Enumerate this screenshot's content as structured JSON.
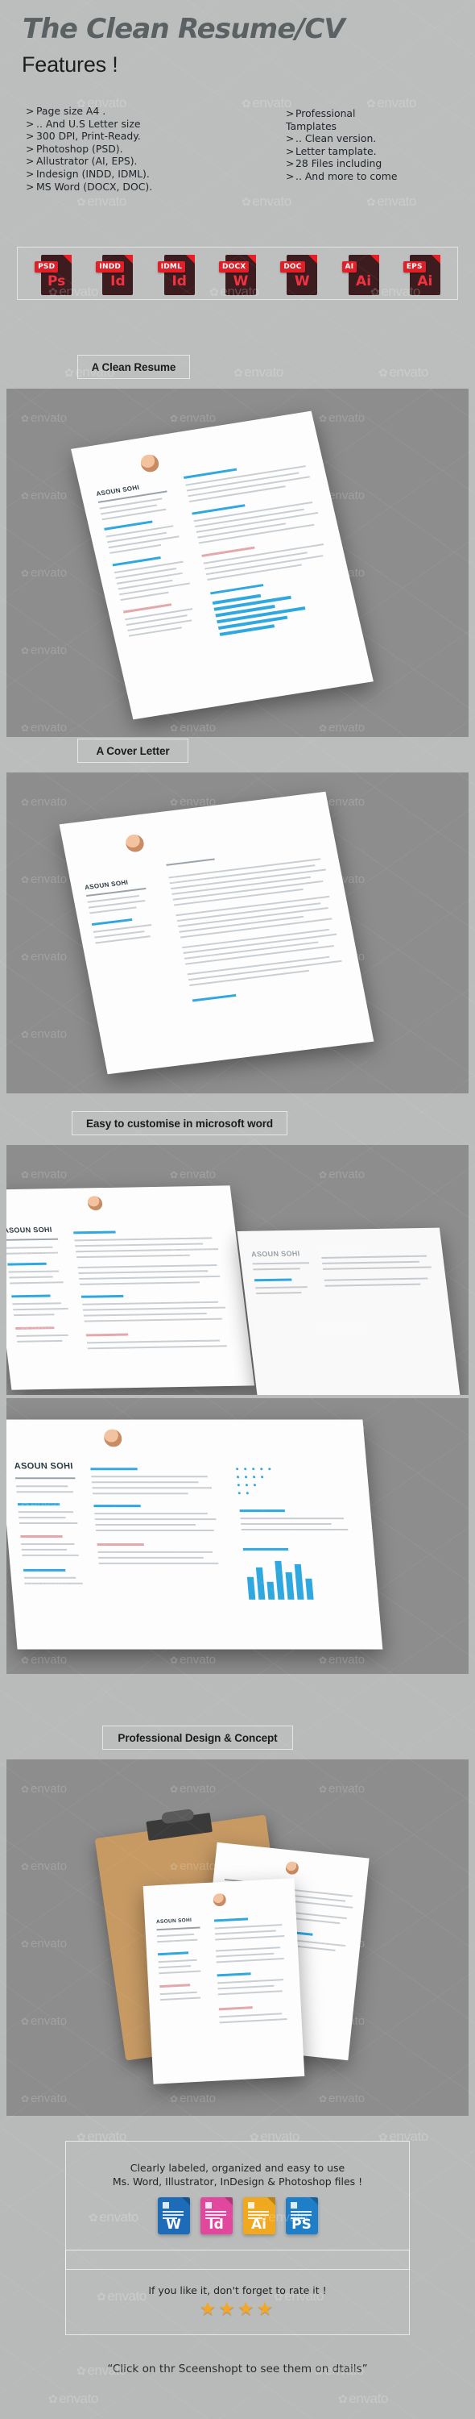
{
  "header": {
    "title": "The Clean Resume/CV",
    "features_heading": "Features !"
  },
  "features": {
    "marker": ">",
    "left": [
      "Page size A4 .",
      ".. And U.S Letter size",
      "300 DPI, Print-Ready.",
      "Photoshop (PSD).",
      "Allustrator (AI, EPS).",
      "Indesign (INDD, IDML).",
      "MS Word (DOCX, DOC)."
    ],
    "right": [
      "Professional",
      "Tamplates",
      ".. Clean version.",
      "Letter tamplate.",
      "28 Files including",
      ".. And more to come"
    ]
  },
  "file_formats": [
    {
      "tag": "PSD",
      "app": "Ps"
    },
    {
      "tag": "INDD",
      "app": "Id"
    },
    {
      "tag": "IDML",
      "app": "Id"
    },
    {
      "tag": "DOCX",
      "app": "W"
    },
    {
      "tag": "DOC",
      "app": "W"
    },
    {
      "tag": "AI",
      "app": "Ai"
    },
    {
      "tag": "EPS",
      "app": "Ai"
    }
  ],
  "sections": [
    {
      "label": "A Clean Resume"
    },
    {
      "label": "A Cover Letter"
    },
    {
      "label": "Easy to customise in microsoft word"
    },
    {
      "label": "Professional Design & Concept"
    }
  ],
  "mockups": {
    "resume_name": "ASOUN SOHI",
    "cover_name": "ASOUN SOHI",
    "word_name_1": "ASOUN SOHI",
    "word_name_2": "ASOUN SOHI",
    "word_name_3": "ASOUN SOHI",
    "concept_name": "ASOUN SOHI"
  },
  "footer": {
    "line1": "Clearly labeled, organized and easy to use",
    "line2": "Ms. Word, Illustrator, InDesign & Photoshop files !",
    "apps": [
      {
        "label": "W",
        "color": "#1e6bb8"
      },
      {
        "label": "Id",
        "color": "#e1479d"
      },
      {
        "label": "Ai",
        "color": "#f0a81e"
      },
      {
        "label": "PS",
        "color": "#1e7ec8"
      }
    ],
    "rate_text": "If you like it, don't forget to rate it !",
    "stars": "★★★★",
    "star_count": 4,
    "bottom_note": "“Click on thr Sceenshopt to see them on dtails”"
  },
  "watermark": {
    "text": "envato"
  },
  "colors": {
    "page_bg": "#b9bbbb",
    "title": "#5b6163",
    "band_bg": "#8d8d8d",
    "format_red": "#e02028",
    "format_dark": "#3d1c1f",
    "accent_blue": "#2fa8df",
    "star": "#f5a623"
  }
}
